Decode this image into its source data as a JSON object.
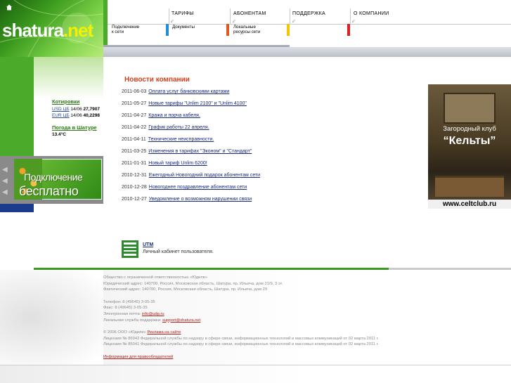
{
  "header": {
    "logo_main": "shatura",
    "logo_dot_net": ".net",
    "nav": [
      {
        "label": "ТАРИФЫ"
      },
      {
        "label": "АБОНЕНТАМ"
      },
      {
        "label": "ПОДДЕРЖКА"
      },
      {
        "label": "О КОМПАНИИ"
      }
    ],
    "subnav": [
      {
        "line1": "Подключение",
        "line2": "к сети",
        "color": "#1e8fd6"
      },
      {
        "line1": "Документы",
        "line2": "",
        "color": "#e2571f"
      },
      {
        "line1": "Локальные",
        "line2": "ресурсы сети",
        "color": "#f2c500"
      },
      {
        "line1": "",
        "line2": "",
        "color": "#e21f1f"
      }
    ]
  },
  "sidebar": {
    "quotes_title": "Котировки",
    "quotes": [
      {
        "currency": "USD ЦБ",
        "date": "14/06",
        "value": "27,7907"
      },
      {
        "currency": "EUR ЦБ",
        "date": "14/06",
        "value": "40,2298"
      }
    ],
    "weather_title": "Погода в Шатуре",
    "weather_value": "13.4°С",
    "banner_line1": "Подключение",
    "banner_line2": "бесплатно"
  },
  "news": {
    "title": "Новости компании",
    "items": [
      {
        "date": "2011-06-03",
        "text": "Оплата услуг банковскими картами"
      },
      {
        "date": "2011-05-27",
        "text": "Новые тарифы \"Unlim 2100\" и \"Unlim 4100\""
      },
      {
        "date": "2011-04-27",
        "text": "Кража и порча кабеля."
      },
      {
        "date": "2011-04-22",
        "text": "График работы 22 апреля."
      },
      {
        "date": "2011-04-11",
        "text": "Технические неисправности."
      },
      {
        "date": "2011-03-25",
        "text": "Изменения в тарифах \"Эконом\" и \"Стандарт\""
      },
      {
        "date": "2011-01-31",
        "text": "Новый тариф Unlim 6200!"
      },
      {
        "date": "2010-12-31",
        "text": "Ежегодный Новогодний подарок абонентам сети"
      },
      {
        "date": "2010-12-28",
        "text": "Новогоднее поздравление абонентам сети"
      },
      {
        "date": "2010-12-27",
        "text": "Уведомление о возможном нарушении связи"
      }
    ]
  },
  "ad": {
    "line1": "Загородный клуб",
    "line2": "“Кельты”",
    "url": "www.celtclub.ru"
  },
  "utm": {
    "title": "UTM",
    "desc": "Личный кабинет пользователя."
  },
  "footer": {
    "company": "Общество с ограниченной ответственностью «Юдили»",
    "legal_address": "Юридический адрес: 140700, Россия, Московская область, Шатура, пр. Ильича, дом 21/9, 3 эт.",
    "actual_address": "Фактический адрес: 140700, Россия, Московская область, Шатура, пр. Ильича, дом 29",
    "phone": "Телефон: 8 (49645) 3-05-35",
    "fax": "Факс: 8 (49645) 3-05-35",
    "email_label": "Электронная почта:",
    "email": "info@udp.ru",
    "support_label": "Локальная служба поддержки:",
    "support_email": "support@shatura.net",
    "copyright": "© 2006 ООО «Юдили»",
    "ads_link": "Реклама на сайте",
    "license1": "Лицензия № 85042 Федеральной службы по надзору в сфере связи, информационных технологий и массовых коммуникаций от 02 марта 2011 г.",
    "license2": "Лицензия № 85041 Федеральной службы по надзору в сфере связи, информационных технологий и массовых коммуникаций от 02 марта 2011 г.",
    "rights_link": "Информация для правообладателей"
  }
}
